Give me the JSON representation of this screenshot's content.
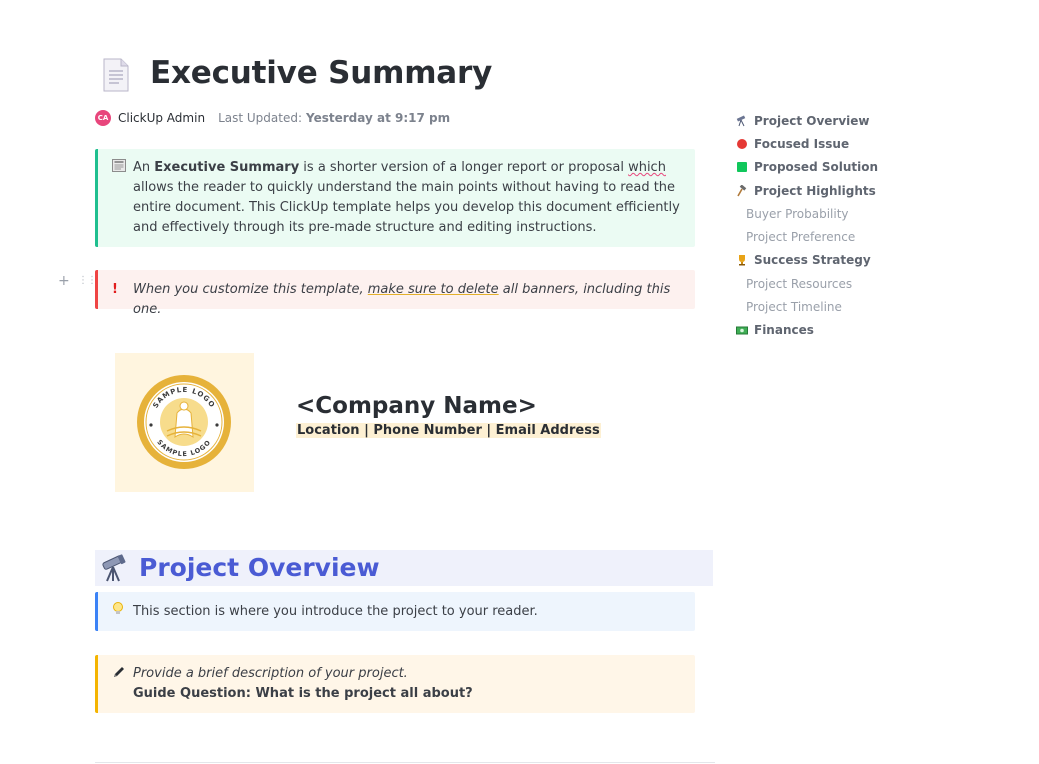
{
  "document": {
    "title": "Executive Summary",
    "author_initials": "CA",
    "author": "ClickUp Admin",
    "last_updated_label": "Last Updated:",
    "last_updated_value": "Yesterday at 9:17 pm"
  },
  "intro_callout": {
    "icon": "newspaper-icon",
    "t1": "An ",
    "t2": "Executive Summary",
    "t3": " is a shorter version of a longer report or proposal ",
    "t4": "which",
    "t5": " allows the reader to quickly understand the main points without having to read the entire document. This ClickUp template helps you develop this document efficiently and effectively through its pre-made structure and editing instructions."
  },
  "warning_callout": {
    "icon": "exclamation-icon",
    "t1": "When you customize this template, ",
    "t2": "make sure to delete",
    "t3": " all banners, including this one."
  },
  "company": {
    "logo_text_top": "SAMPLE LOGO",
    "logo_text_bottom": "SAMPLE LOGO",
    "name": "<Company Name>",
    "details": "Location | Phone Number | Email Address"
  },
  "section": {
    "icon": "telescope-icon",
    "title": "Project Overview"
  },
  "tip_callout": {
    "icon": "lightbulb-icon",
    "text": "This section is where you introduce the project to your reader."
  },
  "guide_callout": {
    "icon": "pen-icon",
    "description": "Provide a brief description of your project.",
    "question": "Guide Question: What is the project all about?"
  },
  "toc": {
    "items": [
      {
        "label": "Project Overview",
        "icon": "telescope-icon",
        "level": 1
      },
      {
        "label": "Focused Issue",
        "icon": "red-circle-icon",
        "level": 1
      },
      {
        "label": "Proposed Solution",
        "icon": "green-square-icon",
        "level": 1
      },
      {
        "label": "Project Highlights",
        "icon": "hammer-icon",
        "level": 1
      },
      {
        "label": "Buyer Probability",
        "level": 2
      },
      {
        "label": "Project Preference",
        "level": 2
      },
      {
        "label": "Success Strategy",
        "icon": "trophy-icon",
        "level": 1
      },
      {
        "label": "Project Resources",
        "level": 2
      },
      {
        "label": "Project Timeline",
        "level": 2
      },
      {
        "label": "Finances",
        "icon": "money-icon",
        "level": 1
      }
    ]
  },
  "colors": {
    "accent": "#4a5bd4",
    "info_border": "#1fbf8f",
    "warn_border": "#ef4444",
    "tip_border": "#3b82f6",
    "guide_border": "#f4b400"
  }
}
